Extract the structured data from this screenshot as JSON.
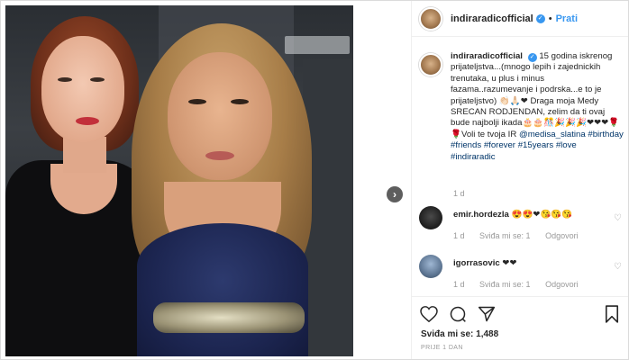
{
  "post": {
    "username": "indiraradicofficial",
    "follow_label": "Prati",
    "separator": "•",
    "caption_text": "15 godina iskrenog prijateljstva...(mnogo lepih i zajednickih trenutaka, u plus i minus fazama..razumevanje i podrska...e to je prijateljstvo) 👏🏻🙏🏻❤ Draga moja Medy SRECAN RODJENDAN, zelim da ti ovaj bude najbolji ikada🎂🎂🎊🎉🎉🎉❤❤❤🌹🌹Voli te tvoja IR",
    "mention": "@medisa_slatina",
    "hashtags": [
      "#birthday",
      "#friends",
      "#forever",
      "#15years",
      "#love",
      "#indiraradic"
    ],
    "caption_time": "1 d"
  },
  "comments": [
    {
      "username": "emir.hordezla",
      "text": "😍😍❤😘😘😘",
      "time": "1 d",
      "likes": "Sviđa mi se: 1",
      "reply": "Odgovori"
    },
    {
      "username": "igorrasovic",
      "text": "❤❤",
      "time": "1 d",
      "likes": "Sviđa mi se: 1",
      "reply": "Odgovori"
    }
  ],
  "footer": {
    "likes_label": "Sviđa mi se: 1,488",
    "posted_ago": "PRIJE 1 DAN"
  },
  "icons": {
    "verified": "verified-badge-icon",
    "like": "heart-icon",
    "comment": "comment-icon",
    "share": "share-icon",
    "save": "bookmark-icon",
    "next": "chevron-right-icon"
  },
  "colors": {
    "link": "#003569",
    "follow": "#3897f0",
    "muted": "#999999"
  }
}
